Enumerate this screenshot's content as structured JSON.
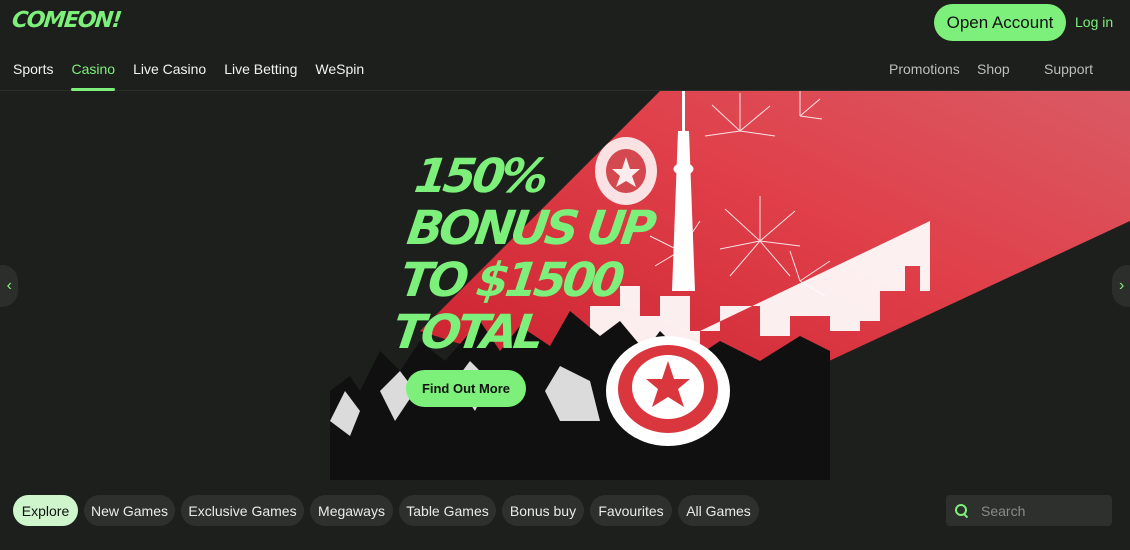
{
  "header": {
    "logo": "COMEON!",
    "open_account": "Open Account",
    "login": "Log in"
  },
  "nav": {
    "left": [
      "Sports",
      "Casino",
      "Live Casino",
      "Live Betting",
      "WeSpin"
    ],
    "active": "Casino",
    "right": [
      "Promotions",
      "Shop",
      "Support"
    ]
  },
  "hero": {
    "title_lines": [
      "150%",
      "BONUS UP",
      "TO $1500",
      "TOTAL"
    ],
    "cta": "Find Out More",
    "prev_icon": "chevron-left-icon",
    "next_icon": "chevron-right-icon",
    "prev_glyph": "‹",
    "next_glyph": "›"
  },
  "filters": {
    "chips": [
      "Explore",
      "New Games",
      "Exclusive Games",
      "Megaways",
      "Table Games",
      "Bonus buy",
      "Favourites",
      "All Games"
    ],
    "active": "Explore",
    "search_placeholder": "Search"
  },
  "colors": {
    "accent": "#7cf07a",
    "background": "#1d1f1c",
    "banner_red": "#d9363e"
  }
}
